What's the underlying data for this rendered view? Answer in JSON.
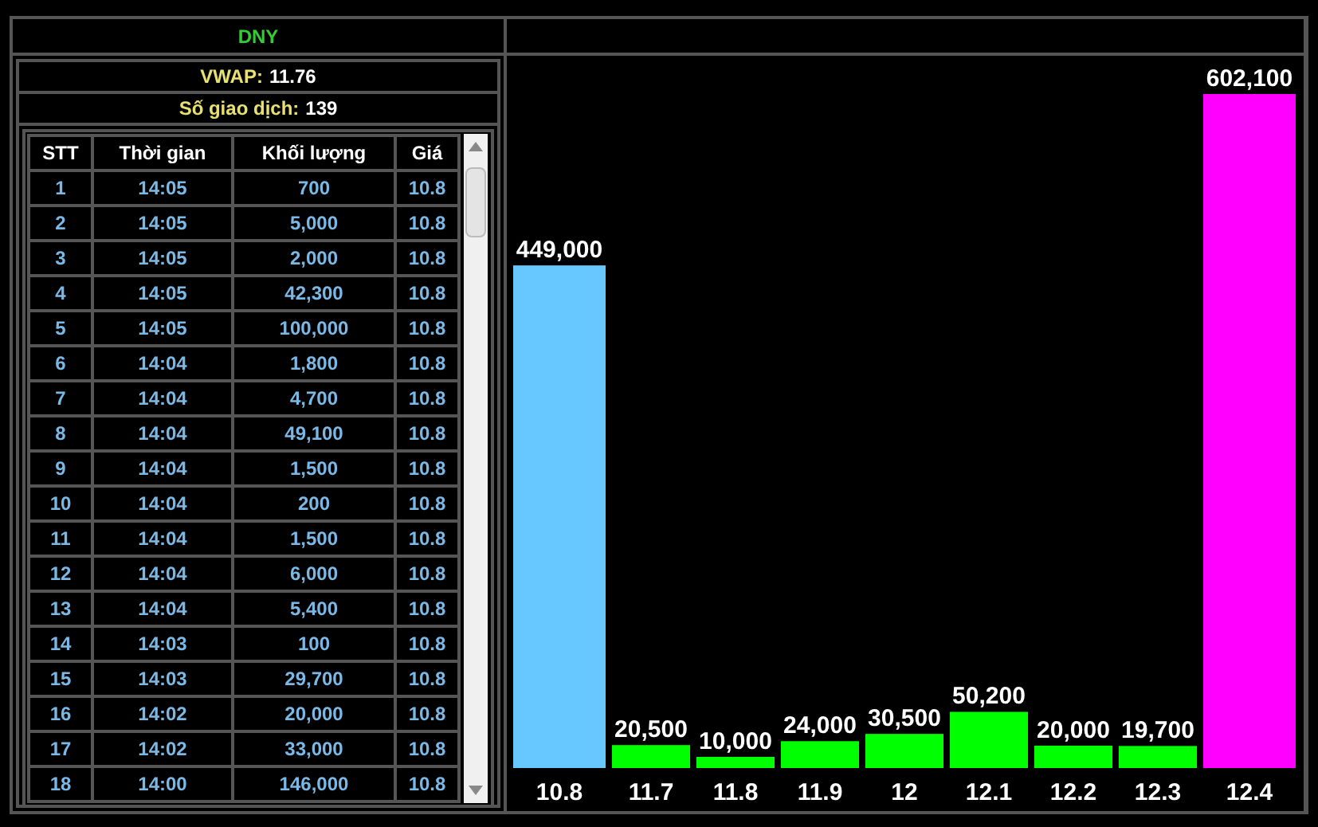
{
  "symbol": "DNY",
  "vwap": {
    "label": "VWAP:",
    "value": "11.76"
  },
  "trades": {
    "label": "Số giao dịch:",
    "value": "139"
  },
  "table": {
    "columns": [
      "STT",
      "Thời gian",
      "Khối lượng",
      "Giá"
    ],
    "rows": [
      [
        "1",
        "14:05",
        "700",
        "10.8"
      ],
      [
        "2",
        "14:05",
        "5,000",
        "10.8"
      ],
      [
        "3",
        "14:05",
        "2,000",
        "10.8"
      ],
      [
        "4",
        "14:05",
        "42,300",
        "10.8"
      ],
      [
        "5",
        "14:05",
        "100,000",
        "10.8"
      ],
      [
        "6",
        "14:04",
        "1,800",
        "10.8"
      ],
      [
        "7",
        "14:04",
        "4,700",
        "10.8"
      ],
      [
        "8",
        "14:04",
        "49,100",
        "10.8"
      ],
      [
        "9",
        "14:04",
        "1,500",
        "10.8"
      ],
      [
        "10",
        "14:04",
        "200",
        "10.8"
      ],
      [
        "11",
        "14:04",
        "1,500",
        "10.8"
      ],
      [
        "12",
        "14:04",
        "6,000",
        "10.8"
      ],
      [
        "13",
        "14:04",
        "5,400",
        "10.8"
      ],
      [
        "14",
        "14:03",
        "100",
        "10.8"
      ],
      [
        "15",
        "14:03",
        "29,700",
        "10.8"
      ],
      [
        "16",
        "14:02",
        "20,000",
        "10.8"
      ],
      [
        "17",
        "14:02",
        "33,000",
        "10.8"
      ],
      [
        "18",
        "14:00",
        "146,000",
        "10.8"
      ]
    ]
  },
  "chart_data": {
    "type": "bar",
    "categories": [
      "10.8",
      "11.7",
      "11.8",
      "11.9",
      "12",
      "12.1",
      "12.2",
      "12.3",
      "12.4"
    ],
    "values": [
      449000,
      20500,
      10000,
      24000,
      30500,
      50200,
      20000,
      19700,
      602100
    ],
    "value_labels": [
      "449,000",
      "20,500",
      "10,000",
      "24,000",
      "30,500",
      "50,200",
      "20,000",
      "19,700",
      "602,100"
    ],
    "colors": [
      "#66c8ff",
      "#00ff00",
      "#00ff00",
      "#00ff00",
      "#00ff00",
      "#00ff00",
      "#00ff00",
      "#00ff00",
      "#ff00ff"
    ]
  }
}
